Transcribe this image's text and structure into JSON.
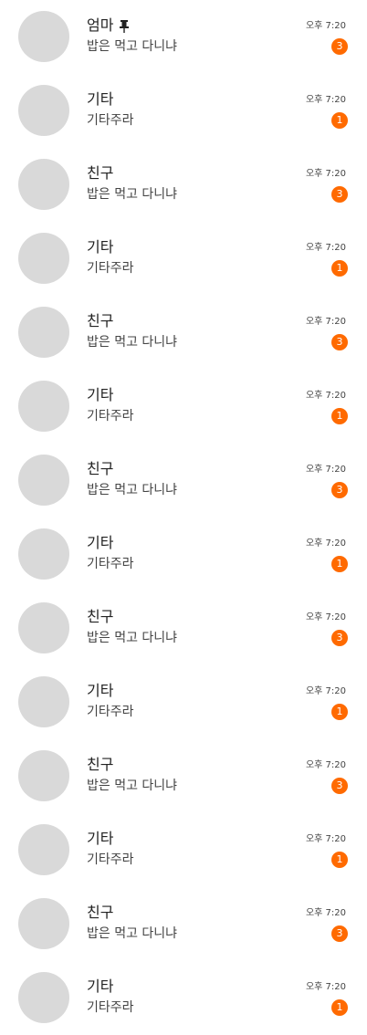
{
  "chats": [
    {
      "name": "엄마",
      "pinned": true,
      "preview": "밥은 먹고 다니냐",
      "time": "오후 7:20",
      "unread": "3"
    },
    {
      "name": "기타",
      "pinned": false,
      "preview": "기타주라",
      "time": "오후 7:20",
      "unread": "1"
    },
    {
      "name": "친구",
      "pinned": false,
      "preview": "밥은 먹고 다니냐",
      "time": "오후 7:20",
      "unread": "3"
    },
    {
      "name": "기타",
      "pinned": false,
      "preview": "기타주라",
      "time": "오후 7:20",
      "unread": "1"
    },
    {
      "name": "친구",
      "pinned": false,
      "preview": "밥은 먹고 다니냐",
      "time": "오후 7:20",
      "unread": "3"
    },
    {
      "name": "기타",
      "pinned": false,
      "preview": "기타주라",
      "time": "오후 7:20",
      "unread": "1"
    },
    {
      "name": "친구",
      "pinned": false,
      "preview": "밥은 먹고 다니냐",
      "time": "오후 7:20",
      "unread": "3"
    },
    {
      "name": "기타",
      "pinned": false,
      "preview": "기타주라",
      "time": "오후 7:20",
      "unread": "1"
    },
    {
      "name": "친구",
      "pinned": false,
      "preview": "밥은 먹고 다니냐",
      "time": "오후 7:20",
      "unread": "3"
    },
    {
      "name": "기타",
      "pinned": false,
      "preview": "기타주라",
      "time": "오후 7:20",
      "unread": "1"
    },
    {
      "name": "친구",
      "pinned": false,
      "preview": "밥은 먹고 다니냐",
      "time": "오후 7:20",
      "unread": "3"
    },
    {
      "name": "기타",
      "pinned": false,
      "preview": "기타주라",
      "time": "오후 7:20",
      "unread": "1"
    },
    {
      "name": "친구",
      "pinned": false,
      "preview": "밥은 먹고 다니냐",
      "time": "오후 7:20",
      "unread": "3"
    },
    {
      "name": "기타",
      "pinned": false,
      "preview": "기타주라",
      "time": "오후 7:20",
      "unread": "1"
    }
  ],
  "pin_icon": "pin-icon",
  "colors": {
    "badge": "#ff6a00",
    "avatar_placeholder": "#d9d9d9"
  }
}
